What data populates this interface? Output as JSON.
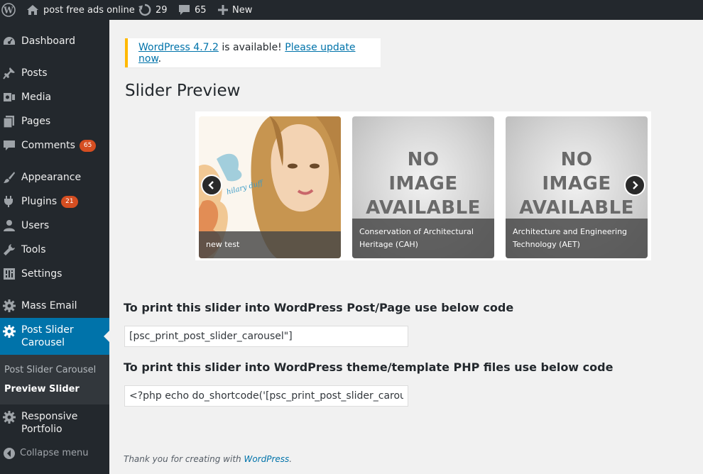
{
  "adminbar": {
    "site_name": "post free ads online",
    "updates_count": "29",
    "comments_count": "65",
    "new_label": "New"
  },
  "sidebar": {
    "items": [
      {
        "label": "Dashboard",
        "icon": "dashboard-icon"
      },
      {
        "label": "Posts",
        "icon": "pushpin-icon"
      },
      {
        "label": "Media",
        "icon": "media-icon"
      },
      {
        "label": "Pages",
        "icon": "pages-icon"
      },
      {
        "label": "Comments",
        "icon": "comment-icon",
        "badge": "65"
      },
      {
        "label": "Appearance",
        "icon": "paintbrush-icon"
      },
      {
        "label": "Plugins",
        "icon": "plugin-icon",
        "badge": "21"
      },
      {
        "label": "Users",
        "icon": "user-icon"
      },
      {
        "label": "Tools",
        "icon": "wrench-icon"
      },
      {
        "label": "Settings",
        "icon": "settings-icon"
      },
      {
        "label": "Mass Email",
        "icon": "gear-icon"
      },
      {
        "label_line1": "Post Slider",
        "label_line2": "Carousel",
        "icon": "gear-icon",
        "current": true
      },
      {
        "label_line1": "Responsive",
        "label_line2": "Portfolio",
        "icon": "gear-icon"
      }
    ],
    "submenu": [
      {
        "label": "Post Slider Carousel"
      },
      {
        "label": "Preview Slider",
        "active": true
      }
    ],
    "collapse_label": "Collapse menu"
  },
  "notice": {
    "link1": "WordPress 4.7.2",
    "middle": " is available! ",
    "link2": "Please update now",
    "end": "."
  },
  "page_title": "Slider Preview",
  "slider": {
    "slides": [
      {
        "caption": "new test",
        "image": "photo"
      },
      {
        "caption": "Conservation of Architectural Heritage (CAH)",
        "image": "no-image",
        "noimg_lines": [
          "NO",
          "IMAGE",
          "AVAILABLE"
        ]
      },
      {
        "caption": "Architecture and Engineering Technology (AET)",
        "image": "no-image",
        "noimg_lines": [
          "NO",
          "IMAGE",
          "AVAILABLE"
        ]
      }
    ]
  },
  "shortcode": {
    "label1": "To print this slider into WordPress Post/Page use below code",
    "value1": "[psc_print_post_slider_carousel\"]",
    "label2": "To print this slider into WordPress theme/template PHP files use below code",
    "value2": "<?php echo do_shortcode('[psc_print_post_slider_carousel]'); ?>"
  },
  "footer": {
    "text": "Thank you for creating with ",
    "link": "WordPress",
    "end": "."
  },
  "colors": {
    "adminbar_bg": "#23282d",
    "sidebar_bg": "#23282d",
    "current_menu_bg": "#0073aa",
    "badge_bg": "#d54e21",
    "notice_border": "#ffb900",
    "link": "#0073aa"
  }
}
